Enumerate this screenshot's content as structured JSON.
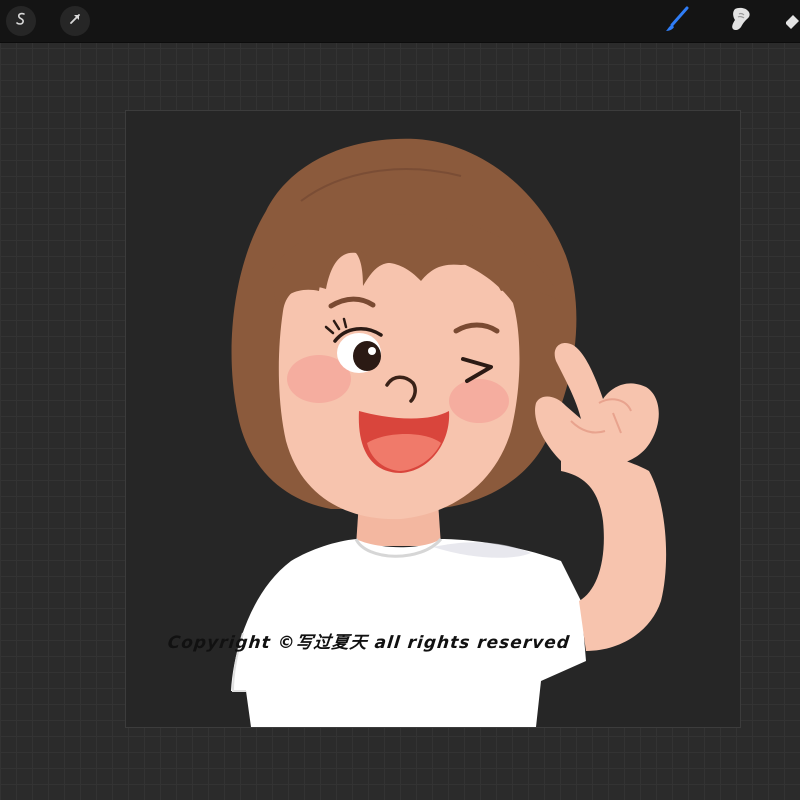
{
  "toolbar": {
    "left_tools": [
      {
        "name": "adjustments-icon"
      },
      {
        "name": "selection-arrow-icon"
      }
    ],
    "right_tools": [
      {
        "name": "brush-icon",
        "active": true,
        "color": "#2f7df6"
      },
      {
        "name": "smudge-icon",
        "active": false
      },
      {
        "name": "eraser-icon",
        "active": false
      }
    ]
  },
  "canvas": {
    "artwork": "cartoon-girl-peace-sign",
    "colors": {
      "hair": "#8b5a3c",
      "skin": "#f7c4ae",
      "cheek": "#f4a59a",
      "mouth": "#d9453c",
      "tongue": "#f07a6a",
      "shirt": "#ffffff"
    },
    "watermark": "Copyright ©写过夏天 all rights reserved"
  }
}
